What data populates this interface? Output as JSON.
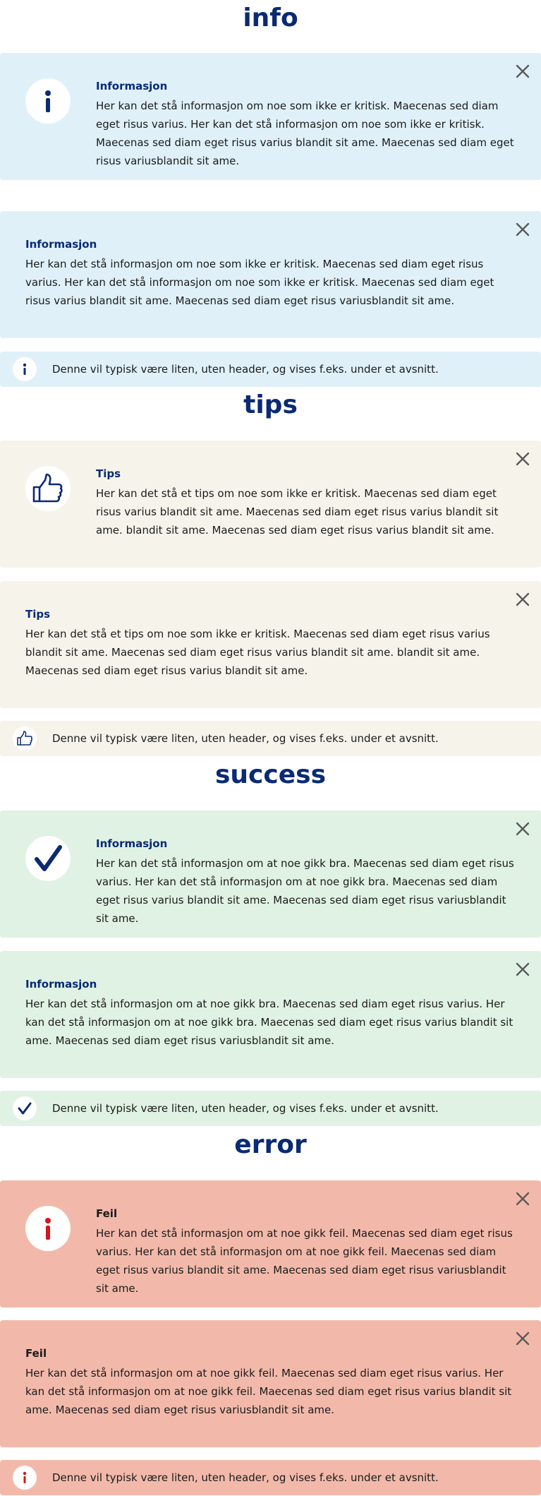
{
  "sections": {
    "info": {
      "title": "info",
      "big": {
        "heading": "Informasjon",
        "body": "Her kan det stå informasjon om noe som ikke er kritisk. Maecenas sed diam eget risus varius. Her kan det stå informasjon om noe som ikke er kritisk. Maecenas sed diam eget risus varius blandit sit ame. Maecenas sed diam eget risus variusblandit sit ame."
      },
      "medium": {
        "heading": "Informasjon",
        "body": "Her kan det stå informasjon om noe som ikke er kritisk. Maecenas sed diam eget risus varius. Her kan det stå informasjon om noe som ikke er kritisk. Maecenas sed diam eget risus varius blandit sit ame. Maecenas sed diam eget risus variusblandit sit ame."
      },
      "small": {
        "body": "Denne vil typisk være liten, uten header, og vises f.eks. under et avsnitt."
      },
      "icon": "info-icon"
    },
    "tips": {
      "title": "tips",
      "big": {
        "heading": "Tips",
        "body": "Her kan det stå et tips om noe som ikke er kritisk. Maecenas sed diam eget risus varius blandit sit ame. Maecenas sed diam eget risus varius blandit sit ame. blandit sit ame. Maecenas sed diam eget risus varius blandit sit ame."
      },
      "medium": {
        "heading": "Tips",
        "body": "Her kan det stå et tips om noe som ikke er kritisk. Maecenas sed diam eget risus varius blandit sit ame. Maecenas sed diam eget risus varius blandit sit ame. blandit sit ame. Maecenas sed diam eget risus varius blandit sit ame."
      },
      "small": {
        "body": "Denne vil typisk være liten, uten header, og vises f.eks. under et avsnitt."
      },
      "icon": "thumbs-up-icon"
    },
    "success": {
      "title": "success",
      "big": {
        "heading": "Informasjon",
        "body": "Her kan det stå informasjon om at noe gikk bra. Maecenas sed diam eget risus varius. Her kan det stå informasjon om at noe gikk bra. Maecenas sed diam eget risus varius blandit sit ame. Maecenas sed diam eget risus variusblandit sit ame."
      },
      "medium": {
        "heading": "Informasjon",
        "body": "Her kan det stå informasjon om at noe gikk bra. Maecenas sed diam eget risus varius. Her kan det stå informasjon om at noe gikk bra. Maecenas sed diam eget risus varius blandit sit ame. Maecenas sed diam eget risus variusblandit sit ame."
      },
      "small": {
        "body": "Denne vil typisk være liten, uten header, og vises f.eks. under et avsnitt."
      },
      "icon": "checkmark-icon"
    },
    "error": {
      "title": "error",
      "big": {
        "heading": "Feil",
        "body": "Her kan det stå informasjon om at noe gikk feil. Maecenas sed diam eget risus varius. Her kan det stå informasjon om at noe gikk feil. Maecenas sed diam eget risus varius blandit sit ame. Maecenas sed diam eget risus variusblandit sit ame."
      },
      "medium": {
        "heading": "Feil",
        "body": "Her kan det stå informasjon om at noe gikk feil. Maecenas sed diam eget risus varius. Her kan det stå informasjon om at noe gikk feil. Maecenas sed diam eget risus varius blandit sit ame. Maecenas sed diam eget risus variusblandit sit ame."
      },
      "small": {
        "body": "Denne vil typisk være liten, uten header, og vises f.eks. under et avsnitt."
      },
      "icon": "error-info-icon"
    }
  },
  "colors": {
    "title": "#0a2a73",
    "info_bg": "#dff0f8",
    "tips_bg": "#f6f4ea",
    "success_bg": "#e0f2e3",
    "error_bg": "#f2b9aa",
    "icon_navy": "#0a2a73",
    "icon_red": "#d0161e",
    "close_gray": "#5a5a5a"
  }
}
